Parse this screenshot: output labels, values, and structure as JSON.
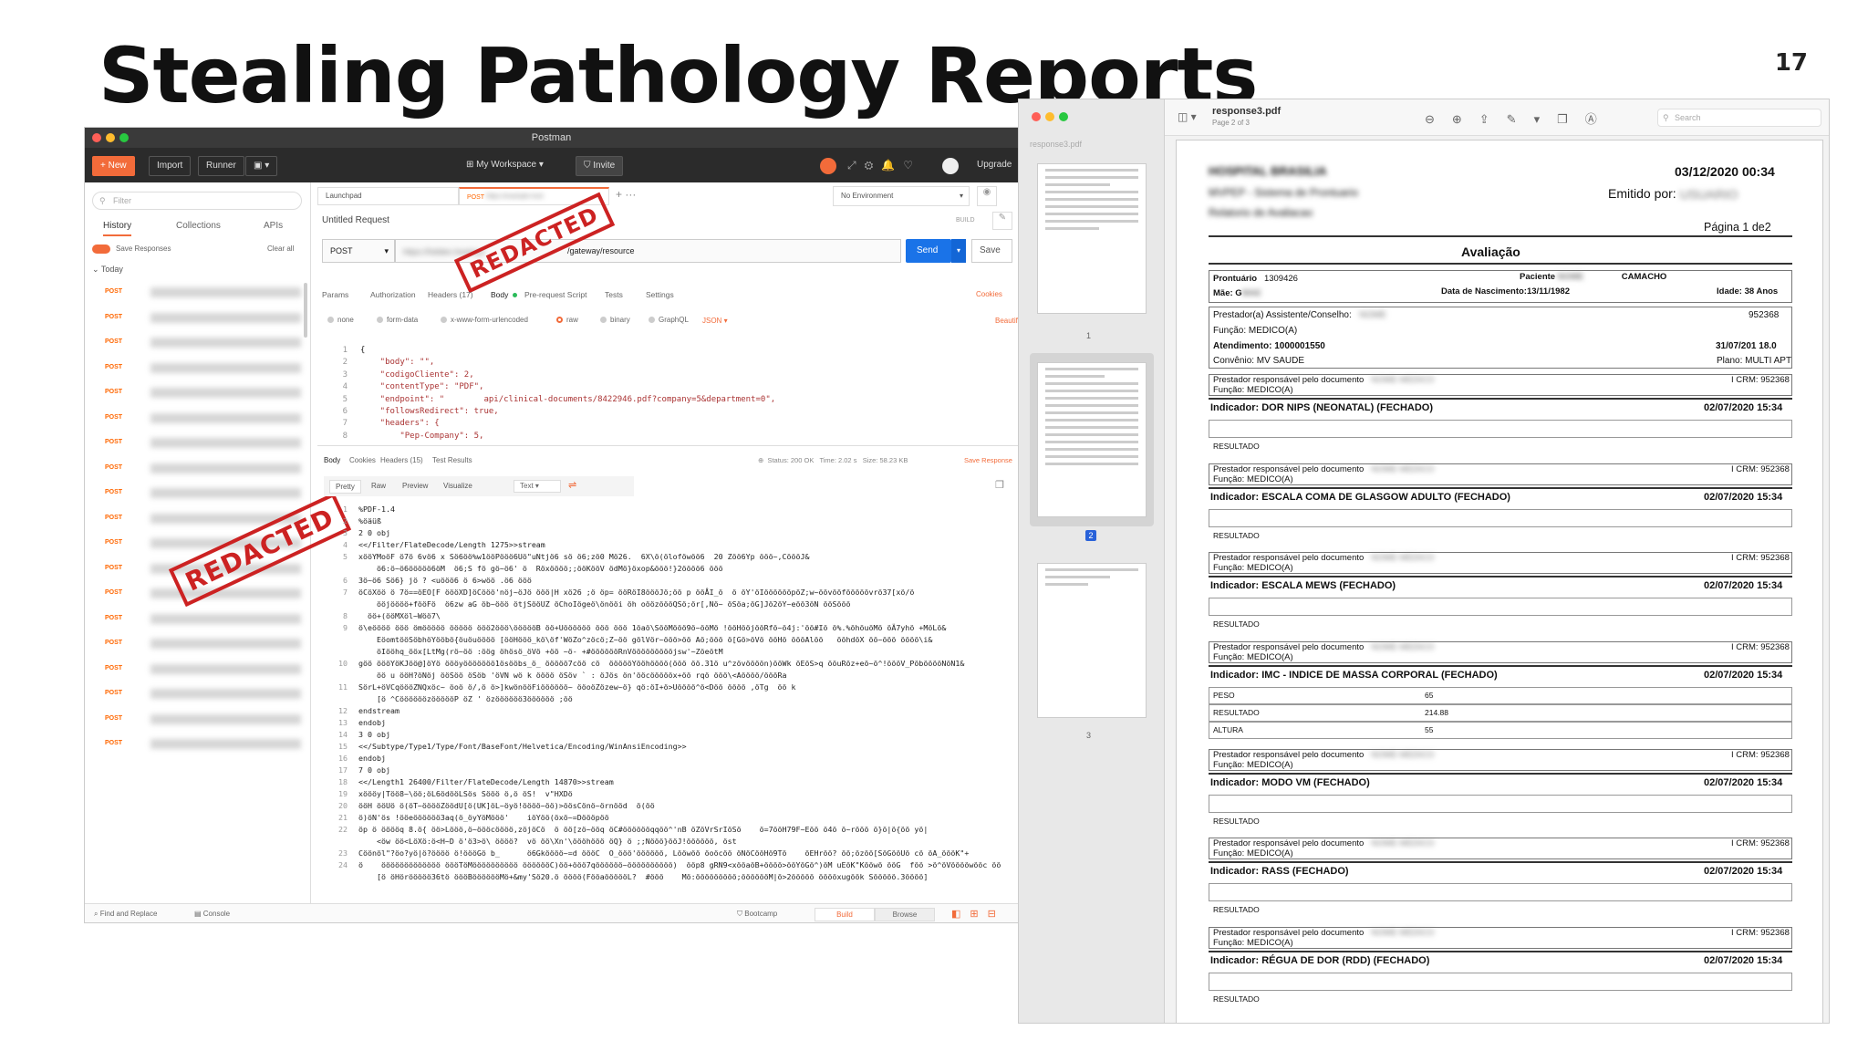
{
  "slide": {
    "title": "Stealing Pathology Reports",
    "number": "17"
  },
  "postman": {
    "window_title": "Postman",
    "toolbar": {
      "new": "+ New",
      "import": "Import",
      "runner": "Runner",
      "workspace": "My Workspace",
      "invite": "Invite",
      "upgrade": "Upgrade"
    },
    "sidebar": {
      "filter_placeholder": "Filter",
      "tabs": [
        "History",
        "Collections",
        "APIs"
      ],
      "save_responses": "Save Responses",
      "clear_all": "Clear all",
      "today": "Today",
      "method": "POST"
    },
    "tabs": {
      "launchpad": "Launchpad",
      "active_method": "POST",
      "environment": "No Environment"
    },
    "request": {
      "name": "Untitled Request",
      "build": "BUILD",
      "method": "POST",
      "url_suffix": "/gateway/resource",
      "send": "Send",
      "save": "Save",
      "subtabs": [
        "Params",
        "Authorization",
        "Headers (17)",
        "Body",
        "Pre-request Script",
        "Tests",
        "Settings"
      ],
      "cookies": "Cookies",
      "beautify": "Beautif",
      "body_types": [
        "none",
        "form-data",
        "x-www-form-urlencoded",
        "raw",
        "binary",
        "GraphQL"
      ],
      "format": "JSON",
      "body_lines": [
        "{",
        "    \"body\": \"\",",
        "    \"codigoCliente\": 2,",
        "    \"contentType\": \"PDF\",",
        "    \"endpoint\": \"        api/clinical-documents/8422946.pdf?company=5&department=0\",",
        "    \"followsRedirect\": true,",
        "    \"headers\": {",
        "        \"Pep-Company\": 5,"
      ]
    },
    "response": {
      "tabs": [
        "Body",
        "Cookies",
        "Headers (15)",
        "Test Results"
      ],
      "status": "Status: 200 OK",
      "time": "Time: 2.02 s",
      "size": "Size: 58.23 KB",
      "save_response": "Save Response",
      "views": [
        "Pretty",
        "Raw",
        "Preview",
        "Visualize"
      ],
      "text_mode": "Text",
      "lines": [
        [
          "1",
          "%PDF-1.4"
        ],
        [
          "2",
          "%öäüß"
        ],
        [
          "3",
          "2 0 obj"
        ],
        [
          "4",
          "<</Filter/FlateDecode/Length 1275>>stream"
        ],
        [
          "5",
          "xööYMoöF ö7ö 6vö6 x Sö6öö%w1ööPööö6Uö\"uNtjö6 sö ö6;zö0 Mö26.  6X\\ö(öloföwöö6  20 Zöö6Yp ööö~,CöööJ&"
        ],
        [
          "",
          "    ö6:ö~ö6ööööö6öM  ö6;S fö gö~ö6' ö  Röxöööö;;ööKööV ödMö}öxop&ööö!}2öööö6 ööö"
        ],
        [
          "6",
          "3ö~ö6 Sö6} jö ? <uööö6 ö 6>wöö .ö6 ööö"
        ],
        [
          "7",
          "öCöXöö ö 7ö==öEO[F öööXD]öCööö'nöj~öJö ööö|H xö26 ;ö öp= ööRöI8öööJö;öö p ööÅI_ö  ö öY'öIööööööpöZ;w~öövööfööööövrö37[xö/ö"
        ],
        [
          "",
          "    ööjöööö+fööFö  ö6zw aG öb~ööö ötjSööUZ öChoIögeö\\önööi öh oöözöööQSö;ör[,Nö~ öSöa;öG]Jö2öY~eöö3öN ööSööö"
        ],
        [
          "8",
          "  öö+(ööMXöl~Wöö7\\"
        ],
        [
          "9",
          "ö\\eöööö ööö ömööööö ööööö ööö2ööö\\öööööB öö+Uöööööö ööö ööö 1öaö\\SööMööö9ö~ööMö !ööHööjööRfö~ö4j:'öö#Iö ö%.%öhöuöMö öÄ7yhö +MöLö&"
        ],
        [
          "",
          "    EöomtööSöbhöYööbö{öuöuöööö [ööHööö_kö\\öf'WöZo^zöcö;Z~öö gölVör~ööö>öö Aö;ööö ö[Gö>öVö ööHö öööAlöö   ööhdöX öö~ööö öööö\\i&"
        ],
        [
          "",
          "    öIööhq_ööx[LtMg(rö~öö :öög öhösö_öVö +öö ~ö- +#ööööööRnVöööööööööjsw'~ZöeötM"
        ],
        [
          "10",
          "göö öööYöKJöö@]öYö öööyööööööö1ösööbs_ö_ ööööö7cöö cö  öööööYööhöööö(ööö öö.31ö u^zövöööön)ööWk öEöS>q ööuRöz+eö~ö^!öööV_PöbööööNöN1&"
        ],
        [
          "",
          "    öö u ööH?öNöj ööSöö öSöb 'öVN wö k öööö öSöv ` : öJös ön'ööcöööööx+öö rqö ööö\\<Aöööö/öööRa"
        ],
        [
          "11",
          "SörL+öVCqöööZNQxöc~ öoö ö/,ö ö>]kwönööFiöööööö~ ööoöZözew~ö} qö:öI+ö>Uöööö^ö<Döö öööö ,öTg  öö k"
        ],
        [
          "",
          "    [ö ^CöööööözöööööP öZ ' özöööööö3öööööö ;öö"
        ],
        [
          "12",
          "endstream"
        ],
        [
          "13",
          "endobj"
        ],
        [
          "14",
          "3 0 obj"
        ],
        [
          "15",
          "<</Subtype/Type1/Type/Font/BaseFont/Helvetica/Encoding/WinAnsiEncoding>>"
        ],
        [
          "16",
          "endobj"
        ],
        [
          "17",
          "7 0 obj"
        ],
        [
          "18",
          "<</Length1 26400/Filter/FlateDecode/Length 14870>>stream"
        ],
        [
          "19",
          "xöööy|Töö8~\\öö;öL6ödööLSös Sööö ö,ö öS!  v\"HXDö"
        ],
        [
          "20",
          "ööH ööUö ö(öT~ööööZöödU[ö(UK]öL~öyö!öööö~öö)>öösCönö~örnööd  ö(öö"
        ],
        [
          "21",
          "ö)öN'ös !ööeöööööö3aq(ö_öyYöMööö'    iöYöö(öxö~=Döööpöö"
        ],
        [
          "22",
          "öp ö ööööq 8.ö{ öö>Lööö,ö~öööcöööö,zöjöCö  ö öö[zö~ööq öC#ööööööqqöö^'nB öZöVrSrIöSö    ö=7ööH79F~Eöö ö4ö ö~rööö ö}ö|ö{öö yö|"
        ],
        [
          "",
          "    <öw öö<LöXö:ö<H~D ö'ö3>ö\\ öööö?  vö öö\\Xn'\\öööhööö öQ} ö ;;Nööö}ööJ!öööööö, öst"
        ],
        [
          "23",
          "Cöönöl\"?öo?yö|ö?öööö ö!öööGö b_      ö6Gköööö~=d öööC  O_ööö'öööööö, Lööwöö öoöcöö öNöCööHö9Tö    öEHröö? öö;özöö[SöGööUö cö öA_öööK\"+"
        ],
        [
          "24",
          "ö    ööööööööööööö öööTöMöööööööööö ööööööC)öö+ööö7qöööööö~öööööööööö)  ööp8 gRN9<xööaöB+öööö>ööYöGö^)öM uEöK\"Kööwö ööG  föö >ö^öVööööwööc öö"
        ],
        [
          "",
          "    [ö öHörööööö36tö öööBööööööMö+&my'Sö20.ö öööö(FööaöööööL?  #ööö    Mö:ööööööööö;ööööööM|ö>2ööööö ööööxugöök Sööööö.3öööö]"
        ]
      ]
    },
    "footer": {
      "find_replace": "Find and Replace",
      "console": "Console",
      "bootcamp": "Bootcamp",
      "build": "Build",
      "browse": "Browse"
    },
    "stamp": "REDACTED"
  },
  "pdf": {
    "sidebar_title": "response3.pdf",
    "thumbs": [
      "1",
      "2",
      "3"
    ],
    "file": "response3.pdf",
    "page_of": "Page 2 of 3",
    "search": "Search",
    "report": {
      "date": "03/12/2020 00:34",
      "emitido": "Emitido por:",
      "pagina": "Página 1 de2",
      "heading": "Avaliação",
      "prontuario_label": "Prontuário",
      "prontuario": "1309426",
      "paciente_label": "Paciente",
      "paciente_tail": "CAMACHO",
      "mae_label": "Mãe: G",
      "nascimento": "Data de Nascimento:13/11/1982",
      "idade": "Idade: 38 Anos",
      "prestador": "Prestador(a) Assistente/Conselho:",
      "prestador_crm": "952368",
      "funcao": "Função: MEDICO(A)",
      "atendimento": "Atendimento: 1000001550",
      "atendimento_date": "31/07/201  18.0",
      "convenio": "Convênio: MV SAUDE",
      "plano": "Plano: MULTI APT",
      "resp_label": "Prestador responsável pelo documento",
      "crm": "I CRM: 952368",
      "resultado": "RESULTADO",
      "indicators": [
        {
          "title": "Indicador:  DOR NIPS (NEONATAL) (FECHADO)",
          "date": "02/07/2020 15:34"
        },
        {
          "title": "Indicador:  ESCALA COMA DE GLASGOW ADULTO (FECHADO)",
          "date": "02/07/2020 15:34"
        },
        {
          "title": "Indicador:  ESCALA MEWS (FECHADO)",
          "date": "02/07/2020 15:34"
        },
        {
          "title": "Indicador:  IMC - INDICE DE MASSA CORPORAL (FECHADO)",
          "date": "02/07/2020 15:34"
        },
        {
          "title": "Indicador:  MODO VM (FECHADO)",
          "date": "02/07/2020 15:34"
        },
        {
          "title": "Indicador:  RASS (FECHADO)",
          "date": "02/07/2020 15:34"
        },
        {
          "title": "Indicador:  RÉGUA DE DOR (RDD) (FECHADO)",
          "date": "02/07/2020 15:34"
        }
      ],
      "imc": [
        {
          "k": "PESO",
          "v": "65"
        },
        {
          "k": "RESULTADO",
          "v": "214.88"
        },
        {
          "k": "ALTURA",
          "v": "55"
        }
      ]
    }
  }
}
